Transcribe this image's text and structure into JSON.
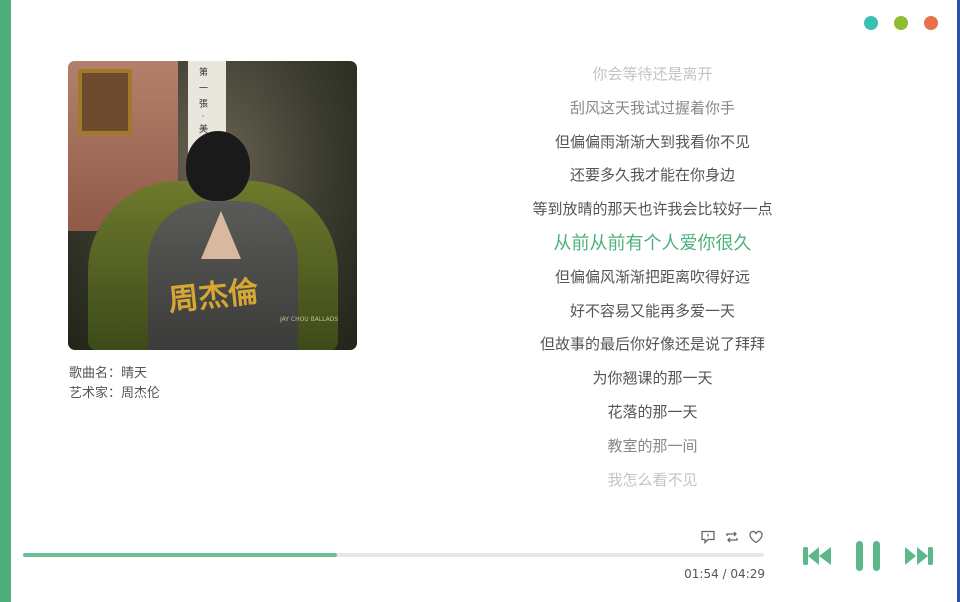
{
  "window": {
    "dots": [
      {
        "name": "dot-teal",
        "color": "#3bbfb2"
      },
      {
        "name": "dot-green",
        "color": "#8fbd32"
      },
      {
        "name": "dot-orange",
        "color": "#e8714c"
      }
    ]
  },
  "album": {
    "banner_text": "第 一 張 · 美",
    "art_title": "周杰倫",
    "art_subtitle": "JAY CHOU BALLADS"
  },
  "song": {
    "title_label": "歌曲名：",
    "title": "晴天",
    "artist_label": "艺术家：",
    "artist": "周杰伦"
  },
  "lyrics": {
    "current_index": 5,
    "lines": [
      "你会等待还是离开",
      "刮风这天我试过握着你手",
      "但偏偏雨渐渐大到我看你不见",
      "还要多久我才能在你身边",
      "等到放晴的那天也许我会比较好一点",
      "从前从前有个人爱你很久",
      "但偏偏风渐渐把距离吹得好远",
      "好不容易又能再多爱一天",
      "但故事的最后你好像还是说了拜拜",
      "为你翘课的那一天",
      "花落的那一天",
      "教室的那一间",
      "我怎么看不见"
    ]
  },
  "player": {
    "elapsed": "01:54",
    "separator": " / ",
    "duration": "04:29",
    "progress": 0.424,
    "accent_color": "#4fb07c",
    "icons": [
      "comment-icon",
      "repeat-icon",
      "heart-icon"
    ],
    "controls": [
      "previous-icon",
      "pause-icon",
      "next-icon"
    ]
  }
}
